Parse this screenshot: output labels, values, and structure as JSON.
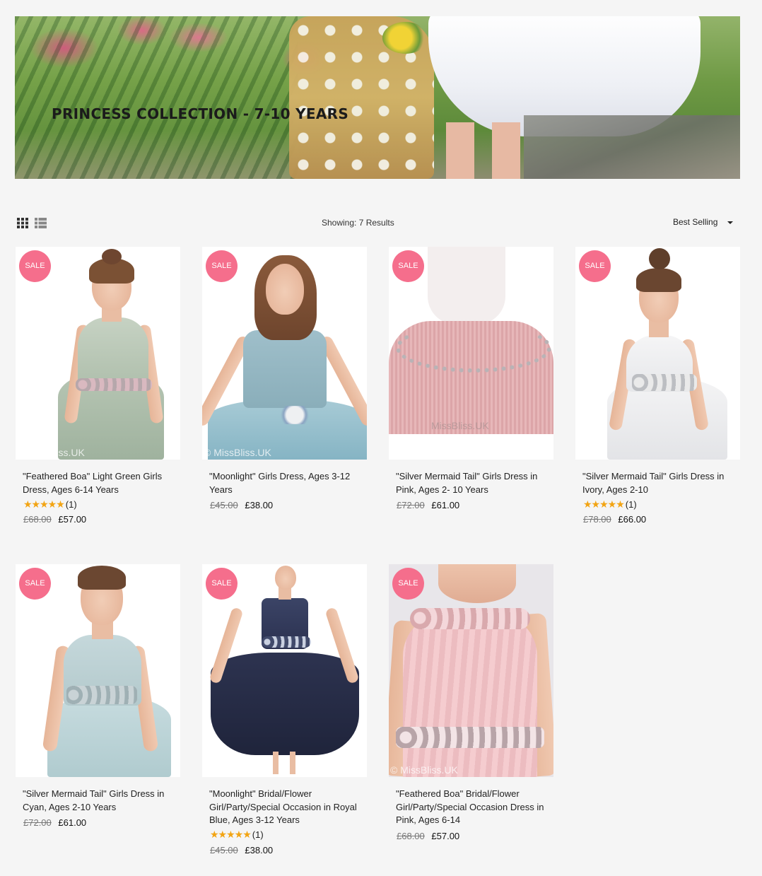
{
  "banner": {
    "title": "PRINCESS COLLECTION - 7-10 YEARS"
  },
  "toolbar": {
    "grid_view_icon": "grid-view-icon",
    "list_view_icon": "list-view-icon",
    "results_text": "Showing: 7 Results",
    "sort_selected": "Best Selling",
    "sort_caret_icon": "chevron-down-icon"
  },
  "colors": {
    "sale_badge": "#f56e8c",
    "star": "#f2a413",
    "background": "#f5f5f5"
  },
  "products": [
    {
      "badge": "SALE",
      "title": "\"Feathered Boa\" Light Green Girls Dress, Ages 6-14 Years",
      "rating_stars": "★★★★★",
      "rating_count": "(1)",
      "old_price": "£68.00",
      "price": "£57.00",
      "watermark": "© MissBliss.UK"
    },
    {
      "badge": "SALE",
      "title": "\"Moonlight\" Girls Dress, Ages 3-12 Years",
      "rating_stars": "",
      "rating_count": "",
      "old_price": "£45.00",
      "price": "£38.00",
      "watermark": "© MissBliss.UK"
    },
    {
      "badge": "SALE",
      "title": "\"Silver Mermaid Tail\" Girls Dress in Pink, Ages 2- 10 Years",
      "rating_stars": "",
      "rating_count": "",
      "old_price": "£72.00",
      "price": "£61.00",
      "watermark": "MissBliss.UK"
    },
    {
      "badge": "SALE",
      "title": "\"Silver Mermaid Tail\" Girls Dress in Ivory, Ages 2-10",
      "rating_stars": "★★★★★",
      "rating_count": "(1)",
      "old_price": "£78.00",
      "price": "£66.00",
      "watermark": ""
    },
    {
      "badge": "SALE",
      "title": "\"Silver Mermaid Tail\" Girls Dress in Cyan, Ages 2-10 Years",
      "rating_stars": "",
      "rating_count": "",
      "old_price": "£72.00",
      "price": "£61.00",
      "watermark": ""
    },
    {
      "badge": "SALE",
      "title": "\"Moonlight\" Bridal/Flower Girl/Party/Special Occasion in Royal Blue, Ages 3-12 Years",
      "rating_stars": "★★★★★",
      "rating_count": "(1)",
      "old_price": "£45.00",
      "price": "£38.00",
      "watermark": ""
    },
    {
      "badge": "SALE",
      "title": "\"Feathered Boa\" Bridal/Flower Girl/Party/Special Occasion Dress in Pink, Ages 6-14",
      "rating_stars": "",
      "rating_count": "",
      "old_price": "£68.00",
      "price": "£57.00",
      "watermark": "© MissBliss.UK"
    }
  ]
}
